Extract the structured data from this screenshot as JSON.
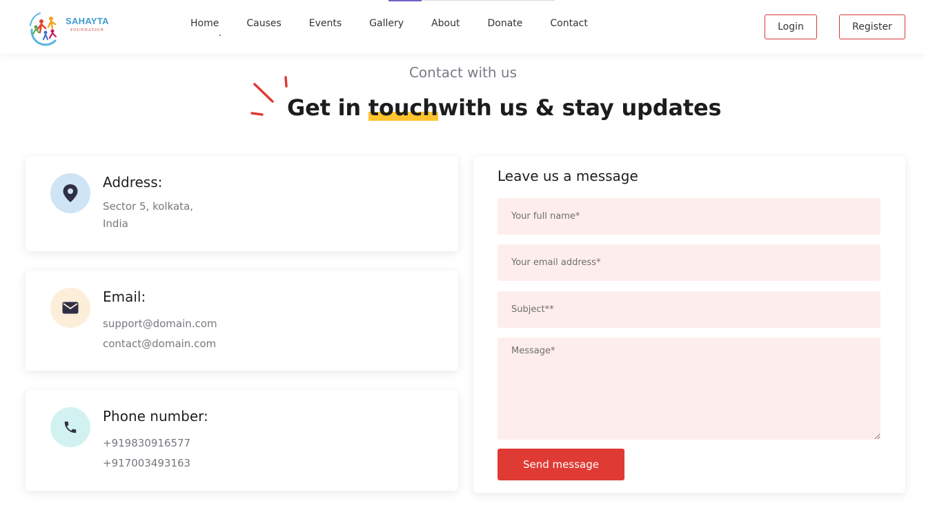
{
  "brand": {
    "name": "SAHAYTA",
    "tagline": "FOUNDATION",
    "colors": {
      "accent": "#e03a34",
      "highlight": "#ffc42e",
      "logo_blue": "#3f9bd1"
    }
  },
  "nav": {
    "items": [
      {
        "label": "Home"
      },
      {
        "label": "Causes"
      },
      {
        "label": "Events"
      },
      {
        "label": "Gallery"
      },
      {
        "label": "About"
      },
      {
        "label": "Donate"
      },
      {
        "label": "Contact"
      }
    ],
    "login_label": "Login",
    "register_label": "Register"
  },
  "hero": {
    "eyebrow": "Contact with us",
    "headline_before": "Get in ",
    "headline_highlight": "touch",
    "headline_after": "with us & stay updates"
  },
  "contact_cards": {
    "address": {
      "icon": "location-pin-icon",
      "title": "Address:",
      "lines": [
        "Sector 5, kolkata,",
        "India"
      ]
    },
    "email": {
      "icon": "envelope-icon",
      "title": "Email:",
      "lines": [
        "support@domain.com",
        "contact@domain.com"
      ]
    },
    "phone": {
      "icon": "phone-icon",
      "title": "Phone number:",
      "lines": [
        "+919830916577",
        "+917003493163"
      ]
    }
  },
  "form": {
    "title": "Leave us a message",
    "name_placeholder": "Your full name*",
    "email_placeholder": "Your email address*",
    "subject_placeholder": "Subject**",
    "message_placeholder": "Message*",
    "submit_label": "Send message"
  }
}
